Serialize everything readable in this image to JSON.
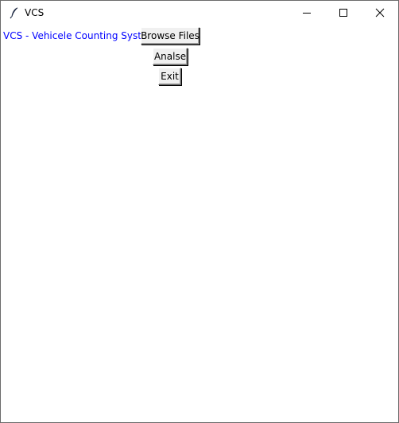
{
  "window": {
    "title": "VCS",
    "icon": "feather-icon",
    "controls": {
      "minimize": "minimize-icon",
      "maximize": "maximize-icon",
      "close": "close-icon"
    }
  },
  "main": {
    "label": "VCS - Vehicele Counting System",
    "label_color": "#0000ff",
    "buttons": {
      "browse": "Browse Files",
      "analyse": "Analse",
      "exit": "Exit"
    }
  }
}
